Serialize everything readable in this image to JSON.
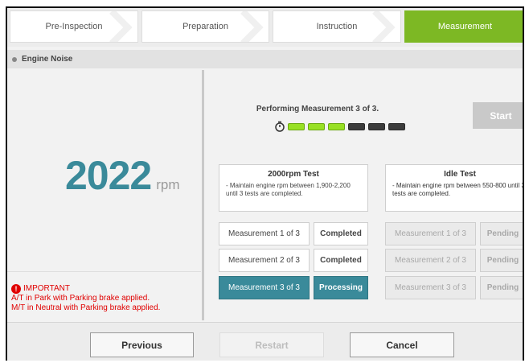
{
  "steps": [
    {
      "label": "Pre-Inspection",
      "active": false
    },
    {
      "label": "Preparation",
      "active": false
    },
    {
      "label": "Instruction",
      "active": false
    },
    {
      "label": "Measurement",
      "active": true
    }
  ],
  "section": {
    "title": "Engine Noise"
  },
  "gauge": {
    "value": "2022",
    "unit": "rpm"
  },
  "important": {
    "heading": "IMPORTANT",
    "lines": [
      "A/T in Park with Parking brake applied.",
      "M/T in Neutral with Parking brake applied."
    ]
  },
  "measurement": {
    "status_text": "Performing Measurement 3 of 3.",
    "progress": {
      "completed": 3,
      "total": 6
    },
    "start_label": "Start"
  },
  "tests": [
    {
      "title": "2000rpm Test",
      "description": "-  Maintain engine rpm between 1,900-2,200 until 3 tests are completed.",
      "rows": [
        {
          "label": "Measurement 1 of 3",
          "status": "Completed"
        },
        {
          "label": "Measurement 2 of 3",
          "status": "Completed"
        },
        {
          "label": "Measurement 3 of 3",
          "status": "Processing"
        }
      ]
    },
    {
      "title": "Idle Test",
      "description": "-  Maintain engine rpm between 550-800 until 3 tests are completed.",
      "rows": [
        {
          "label": "Measurement 1 of 3",
          "status": "Pending"
        },
        {
          "label": "Measurement 2 of 3",
          "status": "Pending"
        },
        {
          "label": "Measurement 3 of 3",
          "status": "Pending"
        }
      ]
    }
  ],
  "footer": {
    "previous_label": "Previous",
    "restart_label": "Restart",
    "cancel_label": "Cancel"
  },
  "colors": {
    "accent_green": "#7db824",
    "teal": "#3a8a9a",
    "important_red": "#e00000"
  }
}
